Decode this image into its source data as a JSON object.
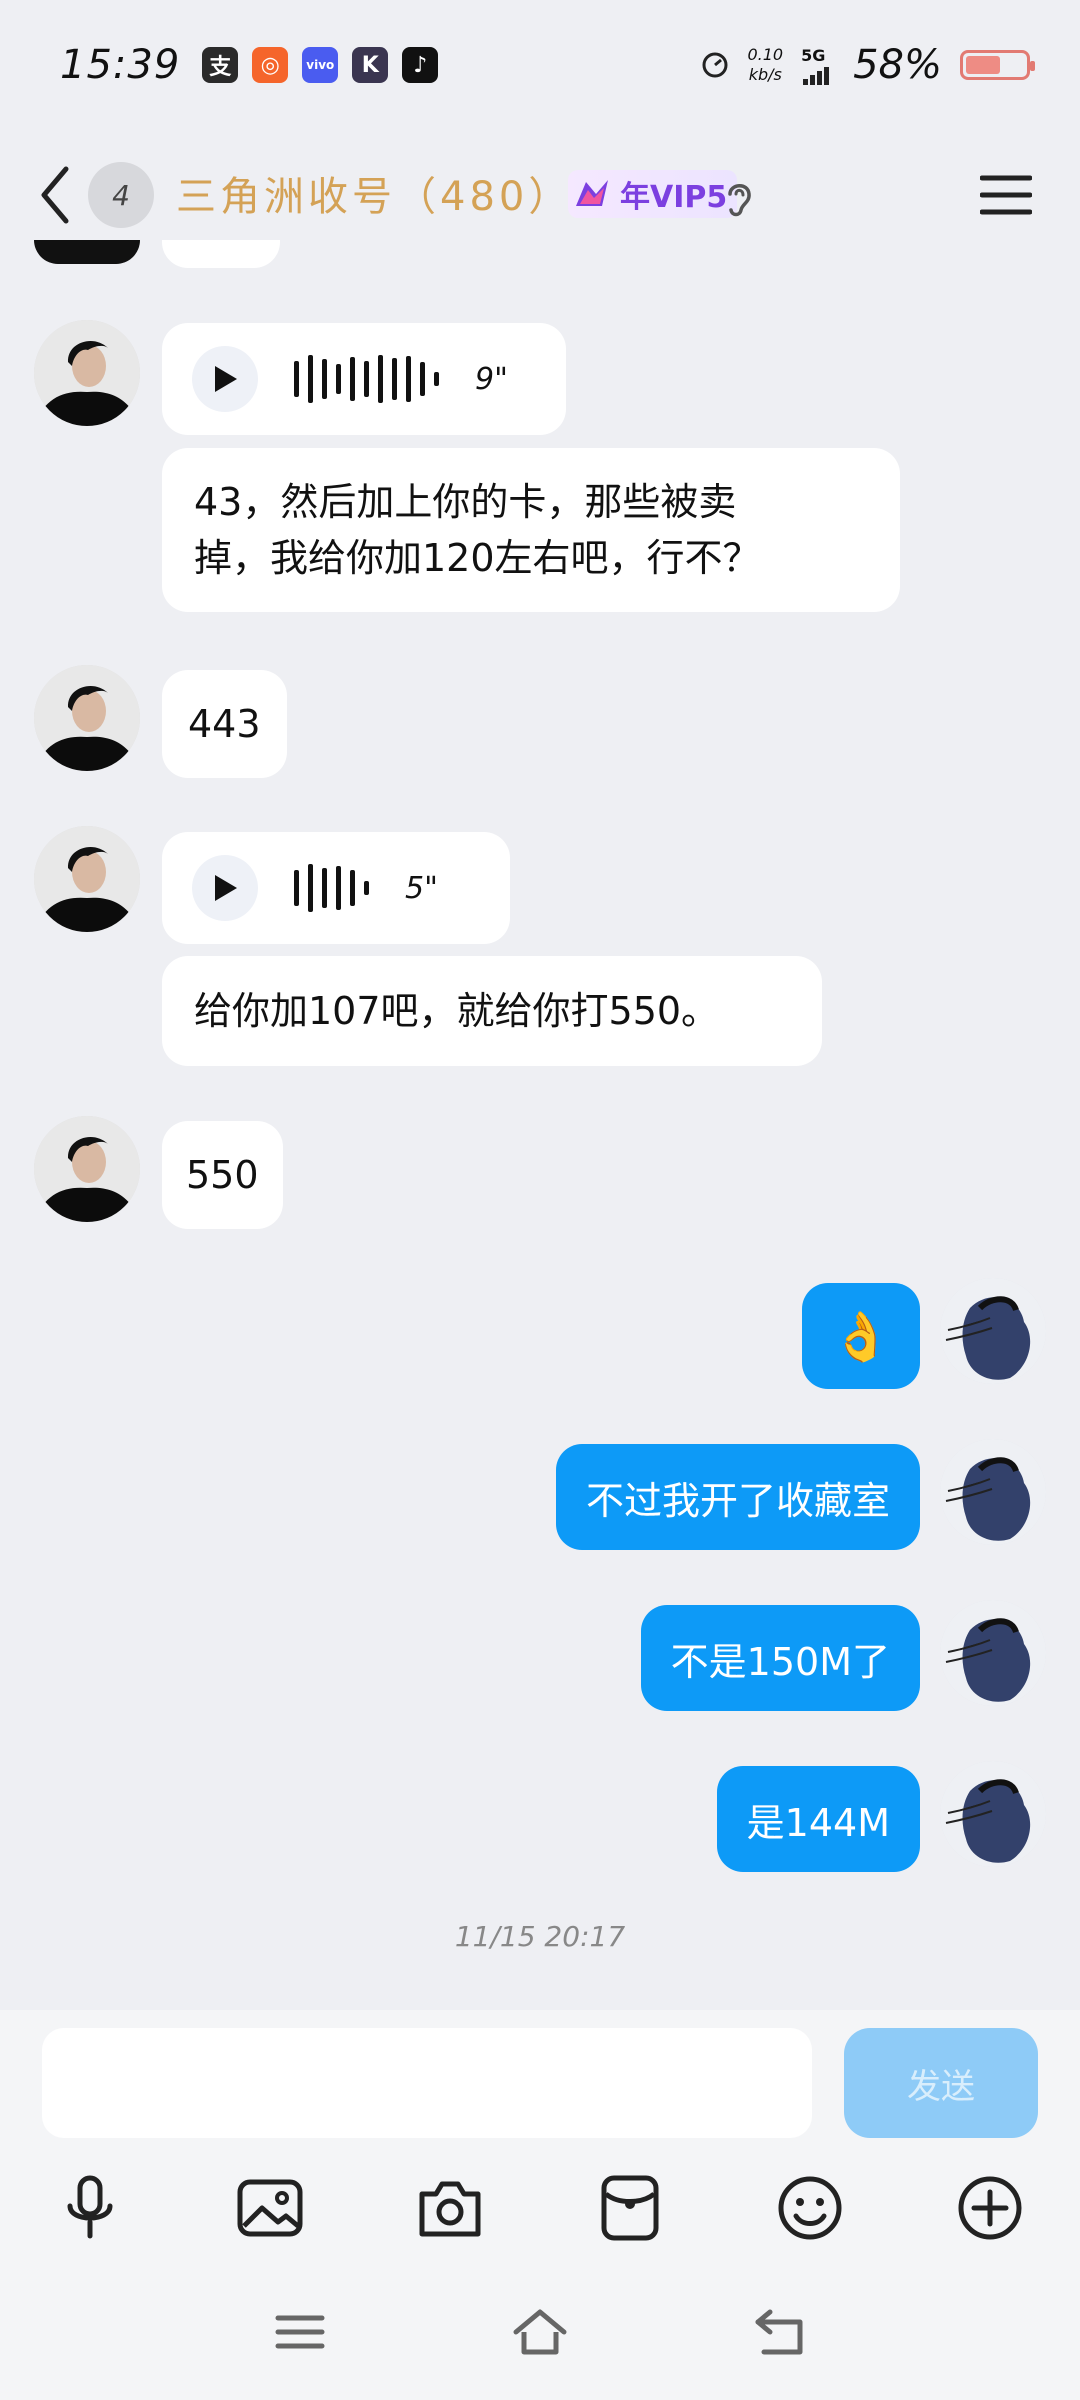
{
  "status_bar": {
    "time": "15:39",
    "apps": [
      {
        "icon": "alipay-icon",
        "glyph": "支",
        "color": "#2a2a2a"
      },
      {
        "icon": "kuaishou-icon",
        "glyph": "◎",
        "color": "#f5652b"
      },
      {
        "icon": "vivo-icon",
        "glyph": "vivo",
        "color": "#4a5cf0"
      },
      {
        "icon": "k-app-icon",
        "glyph": "K",
        "color": "#3a3550"
      },
      {
        "icon": "douyin-icon",
        "glyph": "♪",
        "color": "#111111"
      }
    ],
    "speed_value": "0.10",
    "speed_unit": "kb/s",
    "network": "5G",
    "battery": "58%",
    "battery_level": 0.58
  },
  "header": {
    "unread_count": "4",
    "title": "三角洲收号（480）",
    "vip_label": "年VIP5"
  },
  "messages": {
    "m1": {
      "duration": "9\""
    },
    "m2": {
      "line1": "43，然后加上你的卡，那些被卖",
      "line2": "掉，我给你加120左右吧，行不？"
    },
    "m3": {
      "text": "443"
    },
    "m4": {
      "duration": "5\""
    },
    "m5": {
      "text": "给你加107吧，就给你打550。"
    },
    "m6": {
      "text": "550"
    },
    "m7": {
      "text": "👌"
    },
    "m8": {
      "text": "不过我开了收藏室"
    },
    "m9": {
      "text": "不是150M了"
    },
    "m10": {
      "text": "是144M"
    }
  },
  "timestamp": "11/15 20:17",
  "composer": {
    "placeholder": "",
    "send_label": "发送"
  },
  "colors": {
    "accent": "#0d9af7",
    "title": "#d4a256",
    "vip": "#7c3fe0"
  }
}
